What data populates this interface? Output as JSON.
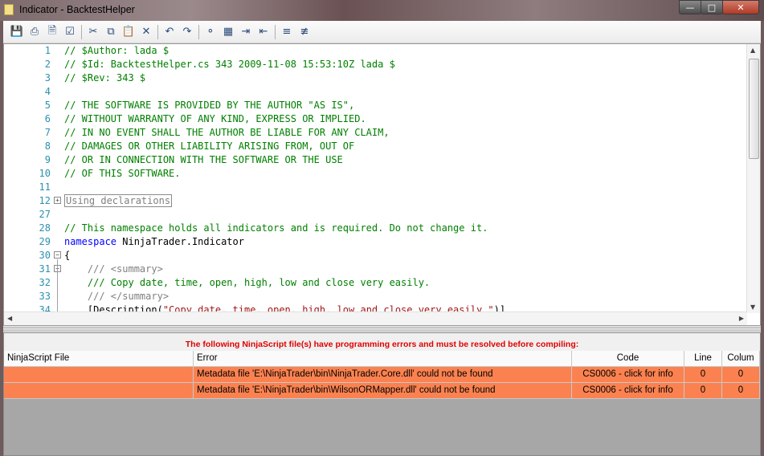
{
  "window": {
    "title": "Indicator - BacktestHelper"
  },
  "toolbar": {
    "icons": [
      "save-icon",
      "print-icon",
      "print-preview-icon",
      "page-setup-icon",
      "cut-icon",
      "copy-icon",
      "paste-icon",
      "delete-icon",
      "undo-icon",
      "redo-icon",
      "find-icon",
      "find-replace-icon",
      "indent-icon",
      "outdent-icon",
      "comment-icon",
      "uncomment-icon"
    ]
  },
  "editor": {
    "lines": [
      {
        "num": "1",
        "parts": [
          {
            "c": "cm",
            "t": "// $Author: lada $"
          }
        ]
      },
      {
        "num": "2",
        "parts": [
          {
            "c": "cm",
            "t": "// $Id: BacktestHelper.cs 343 2009-11-08 15:53:10Z lada $"
          }
        ]
      },
      {
        "num": "3",
        "parts": [
          {
            "c": "cm",
            "t": "// $Rev: 343 $"
          }
        ]
      },
      {
        "num": "4",
        "parts": []
      },
      {
        "num": "5",
        "parts": [
          {
            "c": "cm",
            "t": "// THE SOFTWARE IS PROVIDED BY THE AUTHOR \"AS IS\","
          }
        ]
      },
      {
        "num": "6",
        "parts": [
          {
            "c": "cm",
            "t": "// WITHOUT WARRANTY OF ANY KIND, EXPRESS OR IMPLIED."
          }
        ]
      },
      {
        "num": "7",
        "parts": [
          {
            "c": "cm",
            "t": "// IN NO EVENT SHALL THE AUTHOR BE LIABLE FOR ANY CLAIM,"
          }
        ]
      },
      {
        "num": "8",
        "parts": [
          {
            "c": "cm",
            "t": "// DAMAGES OR OTHER LIABILITY ARISING FROM, OUT OF"
          }
        ]
      },
      {
        "num": "9",
        "parts": [
          {
            "c": "cm",
            "t": "// OR IN CONNECTION WITH THE SOFTWARE OR THE USE"
          }
        ]
      },
      {
        "num": "10",
        "parts": [
          {
            "c": "cm",
            "t": "// OF THIS SOFTWARE."
          }
        ]
      },
      {
        "num": "11",
        "parts": []
      },
      {
        "num": "12",
        "fold": "+",
        "parts": [
          {
            "c": "collapsed",
            "t": "Using declarations"
          }
        ]
      },
      {
        "num": "27",
        "parts": []
      },
      {
        "num": "28",
        "parts": [
          {
            "c": "cm",
            "t": "// This namespace holds all indicators and is required. Do not change it."
          }
        ]
      },
      {
        "num": "29",
        "parts": [
          {
            "c": "kw",
            "t": "namespace"
          },
          {
            "c": "plain",
            "t": " NinjaTrader.Indicator"
          }
        ]
      },
      {
        "num": "30",
        "fold": "-",
        "parts": [
          {
            "c": "plain",
            "t": "{"
          }
        ]
      },
      {
        "num": "31",
        "fold": "-",
        "parts": [
          {
            "c": "plain",
            "t": "    "
          },
          {
            "c": "xml",
            "t": "/// <summary>"
          }
        ]
      },
      {
        "num": "32",
        "parts": [
          {
            "c": "plain",
            "t": "    "
          },
          {
            "c": "cm",
            "t": "/// Copy date, time, open, high, low and close very easily."
          }
        ]
      },
      {
        "num": "33",
        "parts": [
          {
            "c": "plain",
            "t": "    "
          },
          {
            "c": "xml",
            "t": "/// </summary>"
          }
        ]
      },
      {
        "num": "34",
        "parts": [
          {
            "c": "plain",
            "t": "    [Description("
          },
          {
            "c": "str",
            "t": "\"Copy date, time, open, high, low and close very easily.\""
          },
          {
            "c": "plain",
            "t": ")]"
          }
        ]
      }
    ]
  },
  "errors": {
    "banner": "The following NinjaScript file(s) have programming errors and must be resolved before compiling:",
    "columns": [
      "NinjaScript File",
      "Error",
      "Code",
      "Line",
      "Colum"
    ],
    "rows": [
      {
        "file": "",
        "error": "Metadata file 'E:\\NinjaTrader\\bin\\NinjaTrader.Core.dll' could not be found",
        "code": "CS0006 - click for info",
        "line": "0",
        "column": "0"
      },
      {
        "file": "",
        "error": "Metadata file 'E:\\NinjaTrader\\bin\\WilsonORMapper.dll' could not be found",
        "code": "CS0006 - click for info",
        "line": "0",
        "column": "0"
      }
    ]
  },
  "colors": {
    "error_row": "#fb8250",
    "error_text": "#e00000",
    "link": "#1a00ff",
    "comment": "#008000",
    "keyword": "#0000ff"
  }
}
